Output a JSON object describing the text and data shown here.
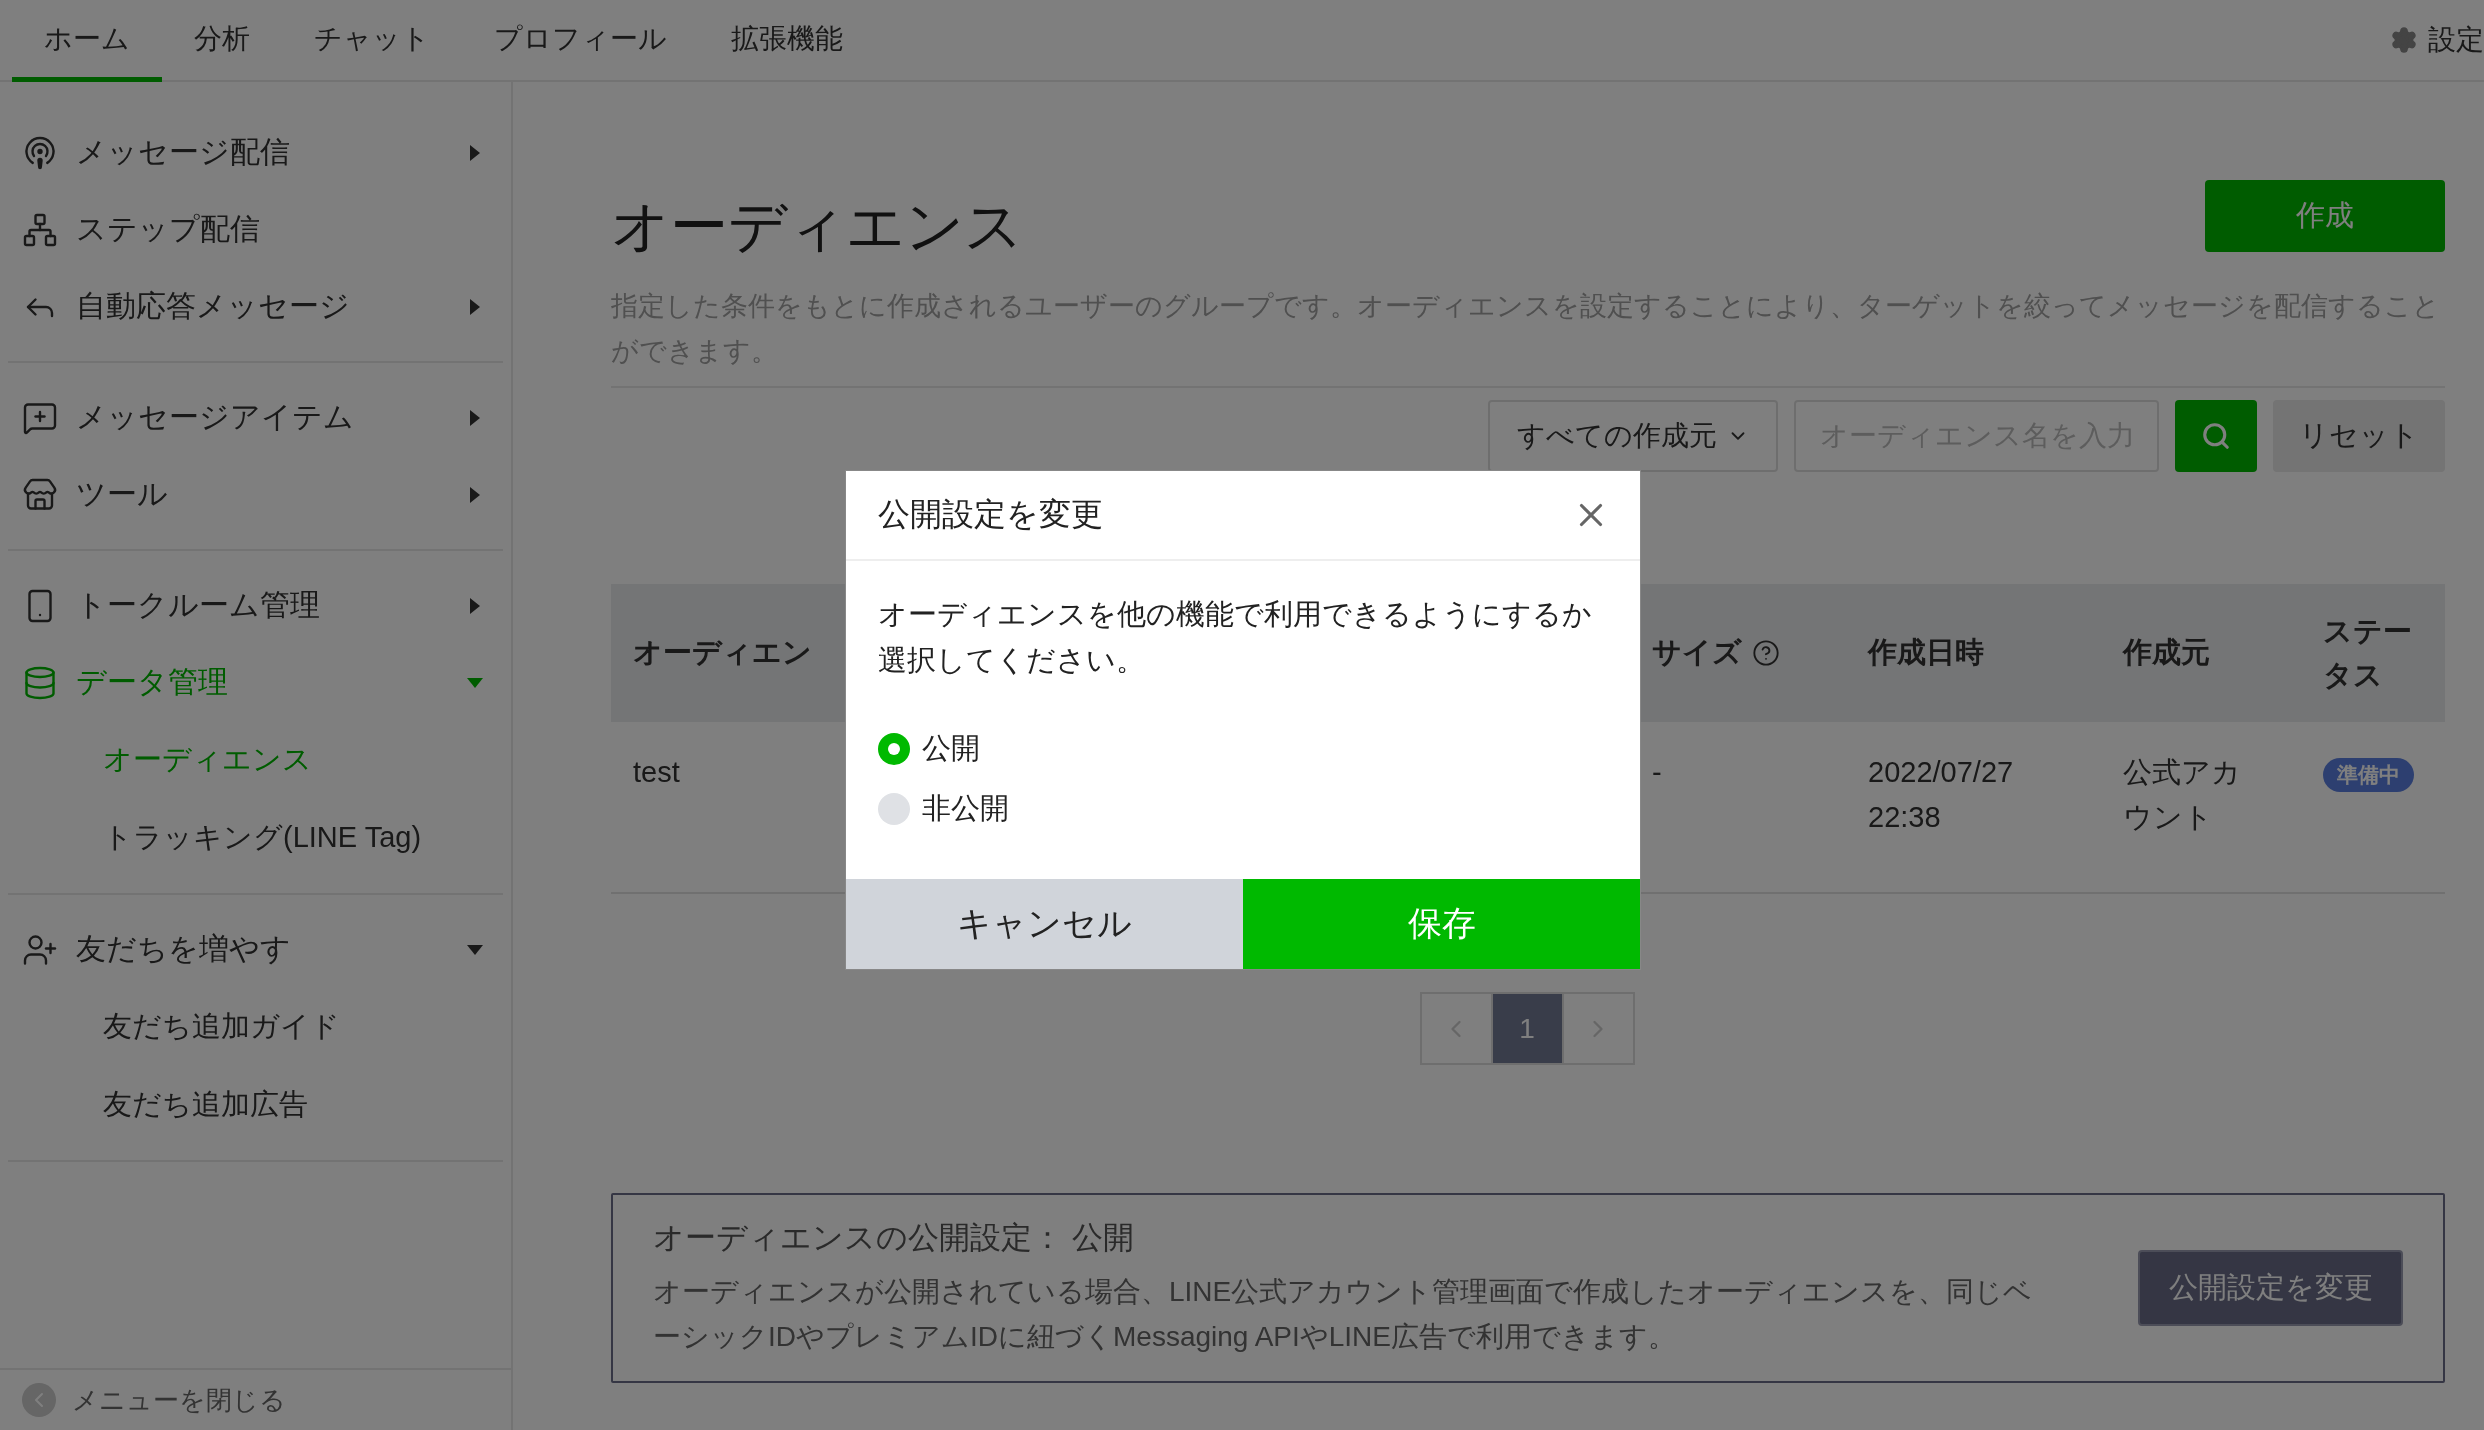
{
  "nav": {
    "tabs": [
      {
        "label": "ホーム",
        "selected": true
      },
      {
        "label": "分析",
        "selected": false
      },
      {
        "label": "チャット",
        "selected": false
      },
      {
        "label": "プロフィール",
        "selected": false
      },
      {
        "label": "拡張機能",
        "selected": false
      }
    ],
    "settings": "設定"
  },
  "sidebar": {
    "groups": [
      {
        "items": [
          {
            "label": "メッセージ配信",
            "kind": "folder",
            "expanded": false,
            "selected": false
          },
          {
            "label": "ステップ配信",
            "kind": "link",
            "selected": false
          },
          {
            "label": "自動応答メッセージ",
            "kind": "folder",
            "expanded": false,
            "selected": false
          }
        ]
      },
      {
        "items": [
          {
            "label": "メッセージアイテム",
            "kind": "folder",
            "expanded": false,
            "selected": false
          },
          {
            "label": "ツール",
            "kind": "folder",
            "expanded": false,
            "selected": false
          }
        ]
      },
      {
        "items": [
          {
            "label": "トークルーム管理",
            "kind": "folder",
            "expanded": false,
            "selected": false
          },
          {
            "label": "データ管理",
            "kind": "folder",
            "expanded": true,
            "selected": true,
            "children": [
              {
                "label": "オーディエンス",
                "selected": true
              },
              {
                "label": "トラッキング(LINE Tag)",
                "selected": false
              }
            ]
          }
        ]
      },
      {
        "items": [
          {
            "label": "友だちを増やす",
            "kind": "folder",
            "expanded": true,
            "selected": false,
            "children": [
              {
                "label": "友だち追加ガイド",
                "selected": false
              },
              {
                "label": "友だち追加広告",
                "selected": false
              }
            ]
          }
        ]
      }
    ],
    "close_menu": "メニューを閉じる"
  },
  "page": {
    "title": "オーディエンス",
    "create_button": "作成",
    "description": "指定した条件をもとに作成されるユーザーのグループです。オーディエンスを設定することにより、ターゲットを絞ってメッセージを配信することができます。",
    "filter": {
      "dropdown": "すべての作成元",
      "search_placeholder": "オーディエンス名を入力",
      "reset": "リセット"
    },
    "table": {
      "columns": [
        {
          "label": "オーディエン",
          "help": false
        },
        {
          "label": "サイズ",
          "help": true
        },
        {
          "label": "作成日時",
          "help": false
        },
        {
          "label": "作成元",
          "help": false
        },
        {
          "label": "ステータス",
          "help": false
        }
      ],
      "rows": [
        {
          "name": "test",
          "size": "-",
          "created": "2022/07/27 22:38",
          "source": "公式アカウント",
          "status": "準備中"
        }
      ]
    },
    "pagination": {
      "pages": [
        {
          "label": "1",
          "selected": true
        }
      ]
    },
    "info": {
      "title": "オーディエンスの公開設定： 公開",
      "text": "オーディエンスが公開されている場合、LINE公式アカウント管理画面で作成したオーディエンスを、同じベーシックIDやプレミアムIDに紐づくMessaging APIやLINE広告で利用できます。",
      "button": "公開設定を変更"
    }
  },
  "modal": {
    "title": "公開設定を変更",
    "body": "オーディエンスを他の機能で利用できるようにするか選択してください。",
    "options": [
      {
        "label": "公開",
        "selected": true
      },
      {
        "label": "非公開",
        "selected": false
      }
    ],
    "cancel": "キャンセル",
    "save": "保存"
  }
}
